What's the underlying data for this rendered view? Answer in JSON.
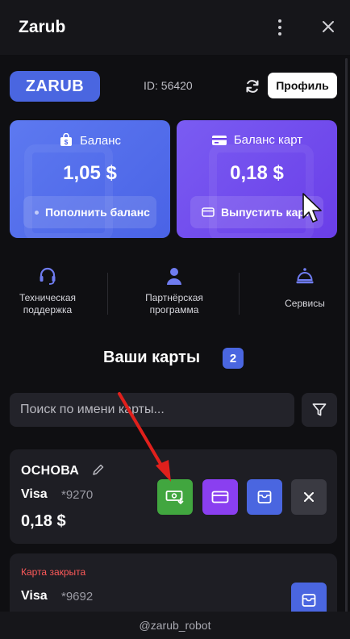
{
  "app": {
    "title": "Zarub"
  },
  "header": {
    "logo": "ZARUB",
    "user_id": "ID: 56420",
    "profile_label": "Профиль"
  },
  "balances": [
    {
      "title": "Баланс",
      "amount": "1,05 $",
      "action": "Пополнить баланс"
    },
    {
      "title": "Баланс карт",
      "amount": "0,18 $",
      "action": "Выпустить карт"
    }
  ],
  "quick_actions": [
    {
      "label": "Техническая\nподдержка",
      "icon": "headset-icon"
    },
    {
      "label": "Партнёрская\nпрограмма",
      "icon": "user-icon"
    },
    {
      "label": "Сервисы",
      "icon": "bell-icon"
    }
  ],
  "cards_section": {
    "title": "Ваши карты",
    "count": "2",
    "search_placeholder": "Поиск по имени карты..."
  },
  "cards": [
    {
      "name": "ОСНОВА",
      "network": "Visa",
      "number": "*9270",
      "amount": "0,18 $",
      "status": ""
    },
    {
      "name": "",
      "network": "Visa",
      "number": "*9692",
      "amount": "",
      "status": "Карта закрыта"
    }
  ],
  "footer": {
    "handle": "@zarub_robot"
  },
  "colors": {
    "accent": "#4a66e0",
    "purple": "#7a5cf2",
    "green": "#41a63f",
    "danger": "#ff5a5a",
    "background": "#0f0f12"
  }
}
